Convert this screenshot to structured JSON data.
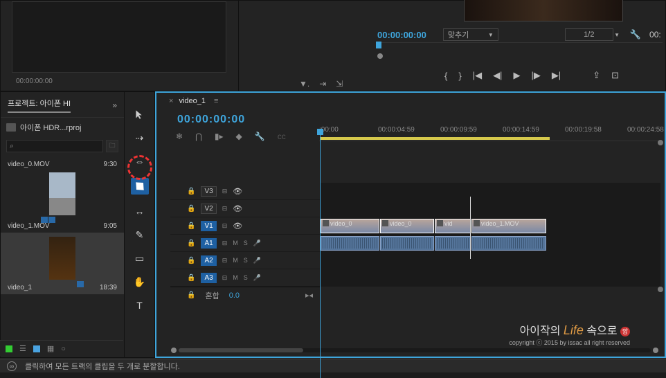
{
  "source": {
    "timecode": "00:00:00:00"
  },
  "program": {
    "timecode": "00:00:00:00",
    "fit_label": "맞추기",
    "scale_label": "1/2",
    "end_tc": "00:"
  },
  "project": {
    "tab_label": "프로젝트: 아이폰 HI",
    "file_name": "아이폰 HDR...rproj",
    "items": [
      {
        "name": "video_0.MOV",
        "dur": "9:30"
      },
      {
        "name": "video_1.MOV",
        "dur": "9:05"
      },
      {
        "name": "video_1",
        "dur": "18:39"
      }
    ]
  },
  "sequence": {
    "name": "video_1",
    "timecode": "00:00:00:00",
    "ruler": [
      ":00:00",
      "00:00:04:59",
      "00:00:09:59",
      "00:00:14:59",
      "00:00:19:58",
      "00:00:24:58"
    ],
    "tracks": {
      "v3": "V3",
      "v2": "V2",
      "v1": "V1",
      "a1": "A1",
      "a2": "A2",
      "a3": "A3",
      "mix": "혼합",
      "mix_val": "0.0"
    },
    "clips": [
      {
        "label": "video_0"
      },
      {
        "label": "video_0"
      },
      {
        "label": "vid"
      },
      {
        "label": "video_1.MOV"
      }
    ]
  },
  "watermark": {
    "line1_a": "아이작의 ",
    "line1_b": "Life",
    "line1_c": " 속으로",
    "badge": "앙",
    "line2": "copyright ⓒ 2015 by issac all right reserved"
  },
  "status": "클릭하여 모든 트랙의 클립을 두 개로 분할합니다."
}
